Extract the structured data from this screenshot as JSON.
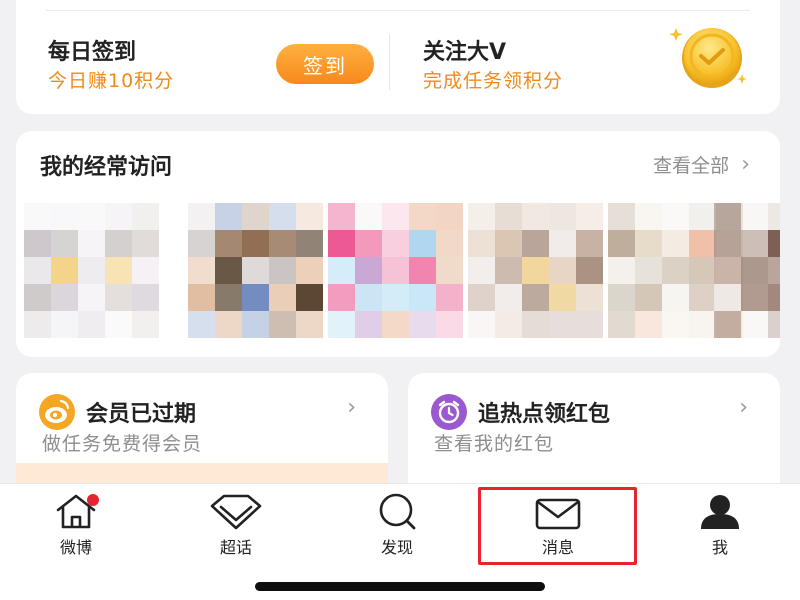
{
  "checkin": {
    "title": "每日签到",
    "subtitle": "今日赚10积分",
    "button": "签到"
  },
  "follow": {
    "title": "关注大V",
    "subtitle": "完成任务领积分",
    "icon": "gold-coin-check-icon"
  },
  "frequent": {
    "title": "我的经常访问",
    "view_all": "查看全部",
    "avatars_blurred": true
  },
  "vip_card": {
    "title": "会员已过期",
    "subtitle": "做任务免费得会员",
    "icon": "weibo-vip-icon"
  },
  "redpack_card": {
    "title": "追热点领红包",
    "subtitle": "查看我的红包",
    "icon": "alarm-clock-icon"
  },
  "tabs": [
    {
      "label": "微博",
      "icon": "home-icon",
      "badge": true
    },
    {
      "label": "超话",
      "icon": "diamond-icon"
    },
    {
      "label": "发现",
      "icon": "search-icon"
    },
    {
      "label": "消息",
      "icon": "envelope-icon",
      "highlighted": true
    },
    {
      "label": "我",
      "icon": "person-icon"
    }
  ],
  "colors": {
    "accent_orange": "#f08a19",
    "badge_red": "#e8232e",
    "highlight_box": "#e8232e",
    "vip_icon": "#f5a623",
    "alarm_icon": "#9b59d0"
  }
}
